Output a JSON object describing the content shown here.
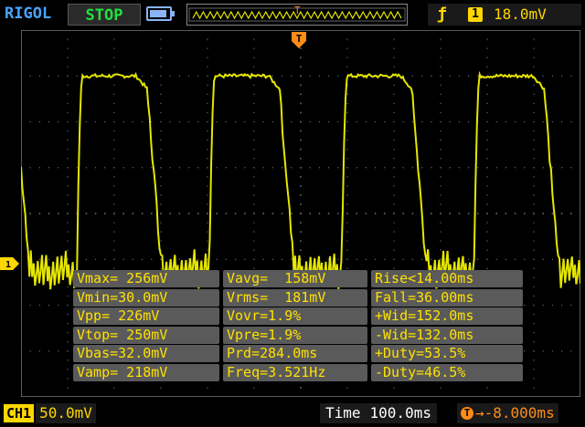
{
  "header": {
    "brand": "RIGOL",
    "run_state": "STOP",
    "trigger": {
      "edge_icon": "rising-edge-icon",
      "source": "1",
      "level": "18.0mV",
      "marker": "T"
    }
  },
  "channel": {
    "marker": "1",
    "label": "CH1",
    "scale": "50.0mV"
  },
  "timebase": {
    "label": "Time",
    "value": "100.0ms"
  },
  "trigger_offset": {
    "icon": "T",
    "value": "→-8.000ms"
  },
  "measurements": [
    [
      "Vmax= 256mV",
      "Vavg=  158mV",
      "Rise<14.00ms"
    ],
    [
      "Vmin=30.0mV",
      "Vrms=  181mV",
      "Fall=36.00ms"
    ],
    [
      "Vpp= 226mV",
      "Vovr=1.9%",
      "+Wid=152.0ms"
    ],
    [
      "Vtop= 250mV",
      "Vpre=1.9%",
      "-Wid=132.0ms"
    ],
    [
      "Vbas=32.0mV",
      "Prd=284.0ms",
      "+Duty=53.5%"
    ],
    [
      "Vamp= 218mV",
      "Freq=3.521Hz",
      "-Duty=46.5%"
    ]
  ],
  "colors": {
    "trace": "#e5e600",
    "brand": "#4aa3ff",
    "stop": "#22e040",
    "trigger": "#ff8c1a",
    "measurement_text": "#ffe100",
    "measurement_bg": "#5a5a5a"
  },
  "chart_data": {
    "type": "line",
    "ylim": [
      -4,
      4
    ],
    "xlim": [
      0,
      12
    ],
    "grid": true,
    "series": [
      {
        "period_divisions": 2.84,
        "high_level_divisions": 3.0,
        "low_level_divisions": -1.25,
        "high_duration_divisions": 1.52,
        "low_duration_divisions": 1.32,
        "low_ripple_divisions": 0.8
      }
    ]
  }
}
